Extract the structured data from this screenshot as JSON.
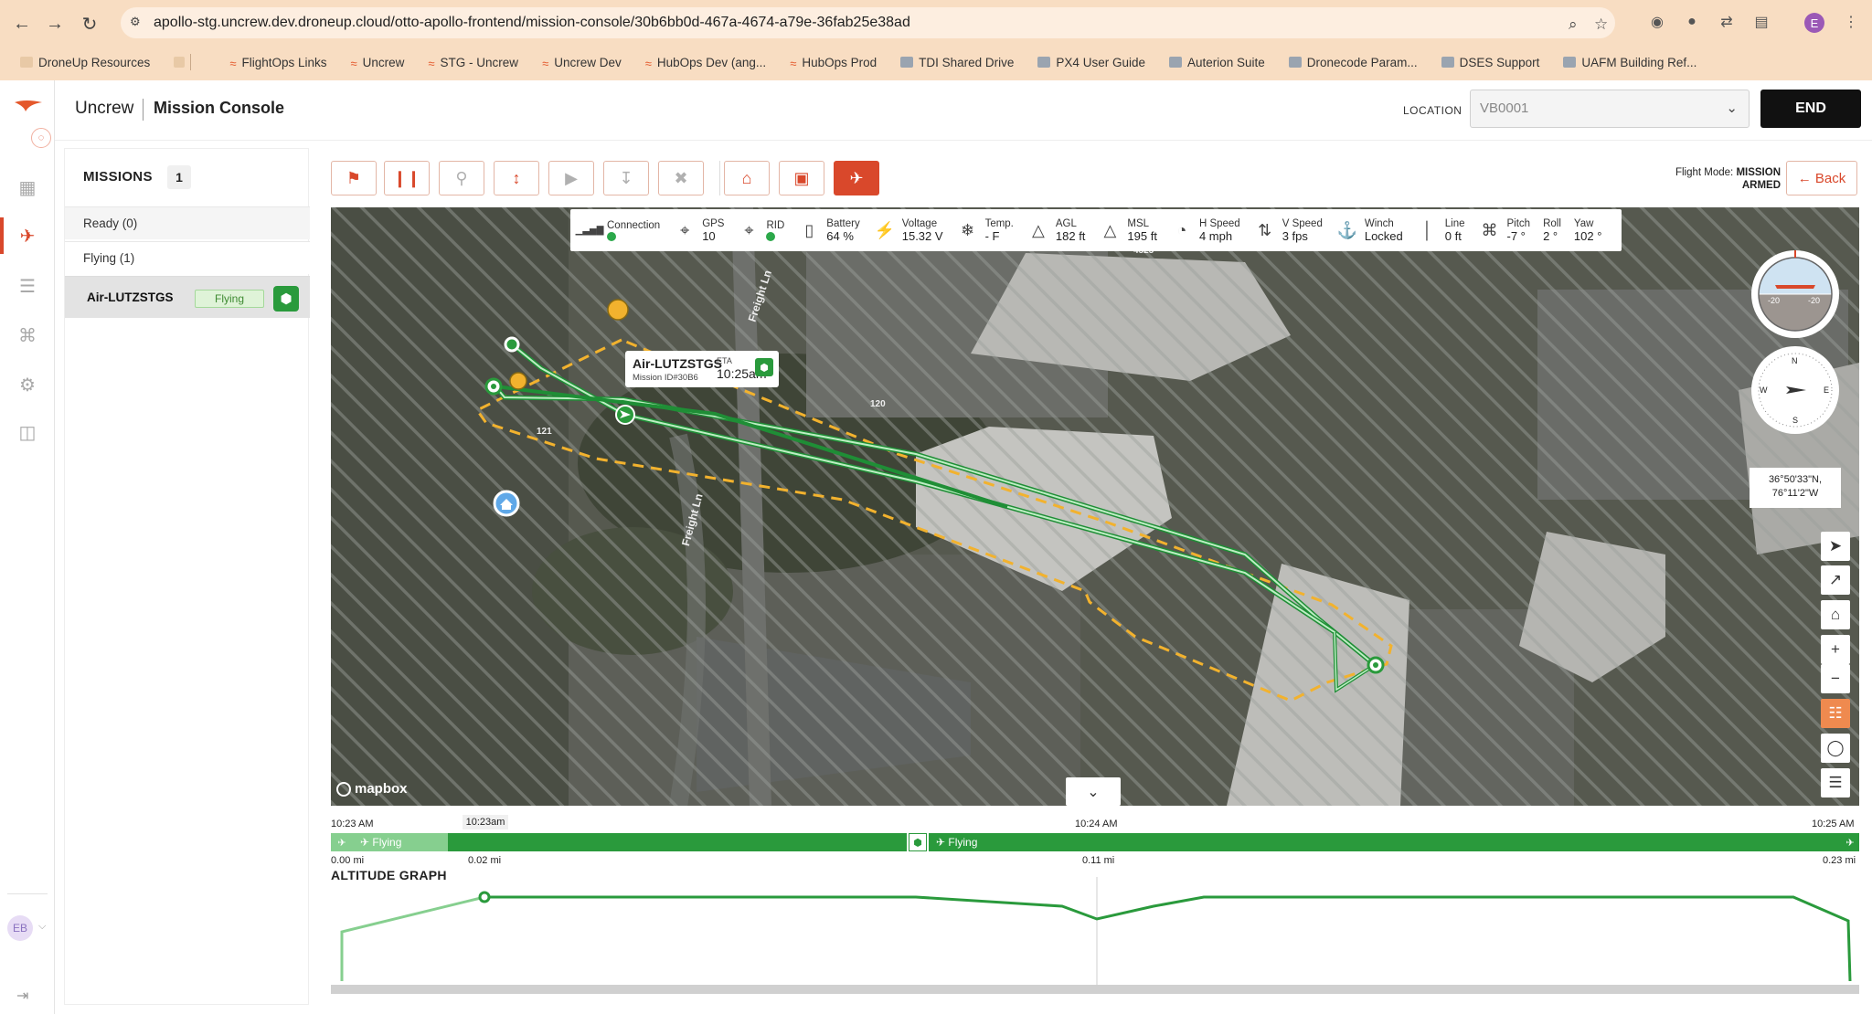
{
  "browser": {
    "url": "apollo-stg.uncrew.dev.droneup.cloud/otto-apollo-frontend/mission-console/30b6bb0d-467a-4674-a79e-36fab25e38ad",
    "profile_initial": "E",
    "bookmarks": [
      {
        "label": "DroneUp Resources",
        "icon": "folder-icon"
      },
      {
        "label": "FlightOps Links",
        "icon": "wave-icon"
      },
      {
        "label": "Uncrew",
        "icon": "wave-icon"
      },
      {
        "label": "STG - Uncrew",
        "icon": "wave-icon"
      },
      {
        "label": "Uncrew Dev",
        "icon": "wave-icon"
      },
      {
        "label": "HubOps Dev (ang...",
        "icon": "wave-icon"
      },
      {
        "label": "HubOps Prod",
        "icon": "wave-icon"
      },
      {
        "label": "TDI Shared Drive",
        "icon": "drive-icon"
      },
      {
        "label": "PX4 User Guide",
        "icon": "book-icon"
      },
      {
        "label": "Auterion Suite",
        "icon": "app-icon"
      },
      {
        "label": "Dronecode Param...",
        "icon": "book-icon"
      },
      {
        "label": "DSES Support",
        "icon": "support-icon"
      },
      {
        "label": "UAFM Building Ref...",
        "icon": "drive-icon"
      }
    ]
  },
  "header": {
    "brand": "Uncrew",
    "title": "Mission Console",
    "location_label": "LOCATION",
    "location_value": "VB0001",
    "end_label": "END"
  },
  "missions": {
    "title": "MISSIONS",
    "count": "1",
    "ready_label": "Ready (0)",
    "flying_label": "Flying (1)",
    "items": [
      {
        "name": "Air-LUTZSTGS",
        "status": "Flying"
      }
    ]
  },
  "toolbar": {
    "flight_mode_label": "Flight Mode:",
    "flight_mode_value": "MISSION",
    "armed_label": "ARMED",
    "back_label": "Back"
  },
  "telemetry": [
    {
      "label": "Connection",
      "value": "",
      "icon": "signal-icon",
      "dot": true
    },
    {
      "label": "GPS",
      "value": "10",
      "icon": "gps-icon"
    },
    {
      "label": "RID",
      "value": "",
      "icon": "rid-icon",
      "dot": true
    },
    {
      "label": "Battery",
      "value": "64 %",
      "icon": "battery-icon"
    },
    {
      "label": "Voltage",
      "value": "15.32 V",
      "icon": "bolt-icon"
    },
    {
      "label": "Temp.",
      "value": "- F",
      "icon": "thermometer-icon"
    },
    {
      "label": "AGL",
      "value": "182 ft",
      "icon": "altitude-icon"
    },
    {
      "label": "MSL",
      "value": "195 ft",
      "icon": "msl-icon"
    },
    {
      "label": "H Speed",
      "value": "4 mph",
      "icon": "speedometer-icon"
    },
    {
      "label": "V Speed",
      "value": "3 fps",
      "icon": "vspeed-icon"
    },
    {
      "label": "Winch",
      "value": "Locked",
      "icon": "winch-icon"
    },
    {
      "label": "Line",
      "value": "0 ft",
      "icon": "line-icon"
    },
    {
      "label": "Pitch",
      "value": "-7 °",
      "icon": "drone-icon"
    },
    {
      "label": "Roll",
      "value": "2 °",
      "icon": ""
    },
    {
      "label": "Yaw",
      "value": "102 °",
      "icon": ""
    }
  ],
  "map": {
    "drone": {
      "name": "Air-LUTZSTGS",
      "mission_id": "Mission ID#30B6",
      "eta_label": "ETA",
      "eta_value": "10:25am"
    },
    "coords_line1": "36°50'33\"N,",
    "coords_line2": "76°11'2\"W",
    "attribution": "mapbox",
    "road_labels": [
      "Freight Ln",
      "Freight Ln"
    ],
    "address_labels": [
      "4525",
      "121",
      "120"
    ],
    "compass": {
      "n": "N",
      "s": "S",
      "e": "E",
      "w": "W"
    },
    "horizon": {
      "left": "-20",
      "right": "-20"
    }
  },
  "timeline": {
    "start_time": "10:23 AM",
    "cursor_time": "10:23am",
    "mid_time": "10:24 AM",
    "end_time": "10:25 AM",
    "phase1": "Flying",
    "phase2": "Flying",
    "dist_start": "0.00 mi",
    "dist_cursor": "0.02 mi",
    "dist_mid": "0.11 mi",
    "dist_end": "0.23 mi",
    "altitude_title": "ALTITUDE GRAPH"
  },
  "colors": {
    "accent": "#d9482b",
    "green": "#2a9a3c",
    "light_green": "#86cf8f",
    "geofence": "#f2b22e"
  }
}
